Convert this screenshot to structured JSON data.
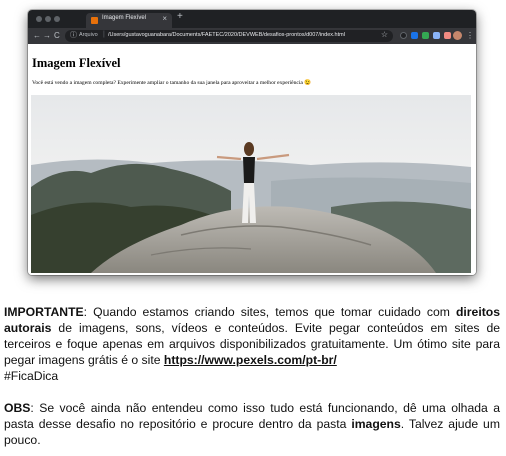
{
  "browser": {
    "tab_title": "Imagem Flexível",
    "tab_close": "×",
    "new_tab": "+",
    "nav_back": "←",
    "nav_forward": "→",
    "nav_reload": "C",
    "site_info": "Arquivo",
    "url": "/Users/gustavoguanabara/Documents/FAETEC/2020/DEVWEB/desafios-prontos/d007/index.html",
    "bookmark_icon": "star-icon",
    "menu_icon": "⋮"
  },
  "page": {
    "title": "Imagem Flexível",
    "paragraph": "Você está vendo a imagem completa? Experimente ampliar o tamanho da sua janela para aproveitar a melhor experiência 😉",
    "image": "woman-arms-outstretched-on-mountain-summit"
  },
  "caption": {
    "important_label": "IMPORTANTE",
    "important_text_1": ": Quando estamos criando sites, temos que tomar cuidado com ",
    "important_bold": "direitos autorais",
    "important_text_2": " de imagens, sons, vídeos e conteúdos. Evite pegar conteúdos em sites de terceiros e foque apenas em arquivos disponibilizados gratuitamente. Um ótimo site para pegar imagens grátis é o site ",
    "important_link": "https://www.pexels.com/pt-br/",
    "hashtag": "#FicaDica",
    "obs_label": "OBS",
    "obs_text_1": ": Se você ainda não entendeu como isso tudo está funcionando, dê uma olhada a pasta desse desafio no repositório e procure dentro da pasta ",
    "obs_bold": "imagens",
    "obs_text_2": ". Talvez ajude um pouco."
  },
  "colors": {
    "tabstrip": "#1f2124",
    "toolbar": "#35363a",
    "omnibox": "#202124",
    "tab_favicon": "#e8710a"
  }
}
